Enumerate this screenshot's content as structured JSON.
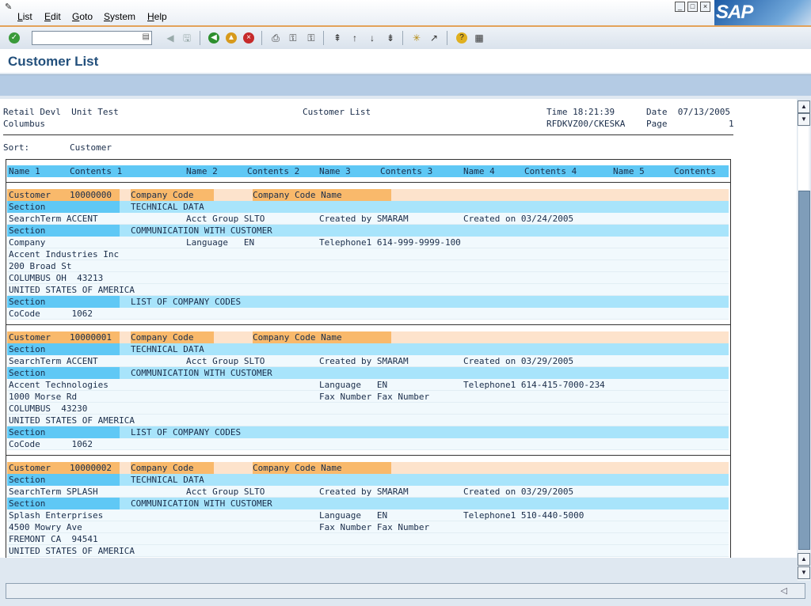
{
  "menu": [
    "List",
    "Edit",
    "Goto",
    "System",
    "Help"
  ],
  "sap_logo": "SAP",
  "command_field": {
    "value": ""
  },
  "toolbar_icons": [
    "enter-icon",
    "back-arrow-icon",
    "save-icon",
    "back-icon",
    "exit-icon",
    "cancel-icon",
    "print-icon",
    "find-icon",
    "find-next-icon",
    "first-page-icon",
    "previous-page-icon",
    "next-page-icon",
    "last-page-icon",
    "create-session-icon",
    "shortcut-icon",
    "help-icon",
    "layout-icon"
  ],
  "title": "Customer List",
  "report_header": {
    "line1_left": "Retail Devl  Unit Test",
    "line1_center": "Customer List",
    "line1_time_label": "Time 18:21:39",
    "line1_date_label": "Date  07/13/2005",
    "line2_left": "Columbus",
    "line2_program": "RFDKVZ00/CKESKA",
    "line2_page_label": "Page",
    "line2_page_value": "1",
    "sort_label": "Sort:",
    "sort_value": "Customer"
  },
  "column_header": [
    "Name 1",
    "Contents 1",
    "Name 2",
    "Contents 2",
    "Name 3",
    "Contents 3",
    "Name 4",
    "Contents 4",
    "Name 5",
    "Contents"
  ],
  "labels": {
    "customer": "Customer",
    "company_code": "Company Code",
    "company_code_name": "Company Code Name",
    "section": "Section",
    "technical_data": "TECHNICAL DATA",
    "communication": "COMMUNICATION WITH CUSTOMER",
    "list_company_codes": "LIST OF COMPANY CODES"
  },
  "customers": [
    {
      "number": "10000000",
      "search_term": "SearchTerm ACCENT",
      "acct_group": "Acct Group SLTO",
      "created_by": "Created by SMARAM",
      "created_on": "Created on 03/24/2005",
      "comm_row1_col1": "Company",
      "comm_row1_col2": "Language   EN",
      "comm_row1_col3": "Telephone1 614-999-9999-100",
      "address": [
        "Accent Industries Inc",
        "200 Broad St",
        "COLUMBUS OH  43213",
        "UNITED STATES OF AMERICA"
      ],
      "cocode": "CoCode      1062"
    },
    {
      "number": "10000001",
      "search_term": "SearchTerm ACCENT",
      "acct_group": "Acct Group SLTO",
      "created_by": "Created by SMARAM",
      "created_on": "Created on 03/29/2005",
      "address": [
        "Accent Technologies",
        "1000 Morse Rd",
        "COLUMBUS  43230",
        "UNITED STATES OF AMERICA"
      ],
      "language": "Language   EN",
      "telephone": "Telephone1 614-415-7000-234",
      "fax": "Fax Number Fax Number",
      "cocode": "CoCode      1062"
    },
    {
      "number": "10000002",
      "search_term": "SearchTerm SPLASH",
      "acct_group": "Acct Group SLTO",
      "created_by": "Created by SMARAM",
      "created_on": "Created on 03/29/2005",
      "address": [
        "Splash Enterprises",
        "4500 Mowry Ave",
        "FREMONT CA  94541",
        "UNITED STATES OF AMERICA"
      ],
      "language": "Language   EN",
      "telephone": "Telephone1 510-440-5000",
      "fax": "Fax Number Fax Number"
    }
  ],
  "status_text": ""
}
